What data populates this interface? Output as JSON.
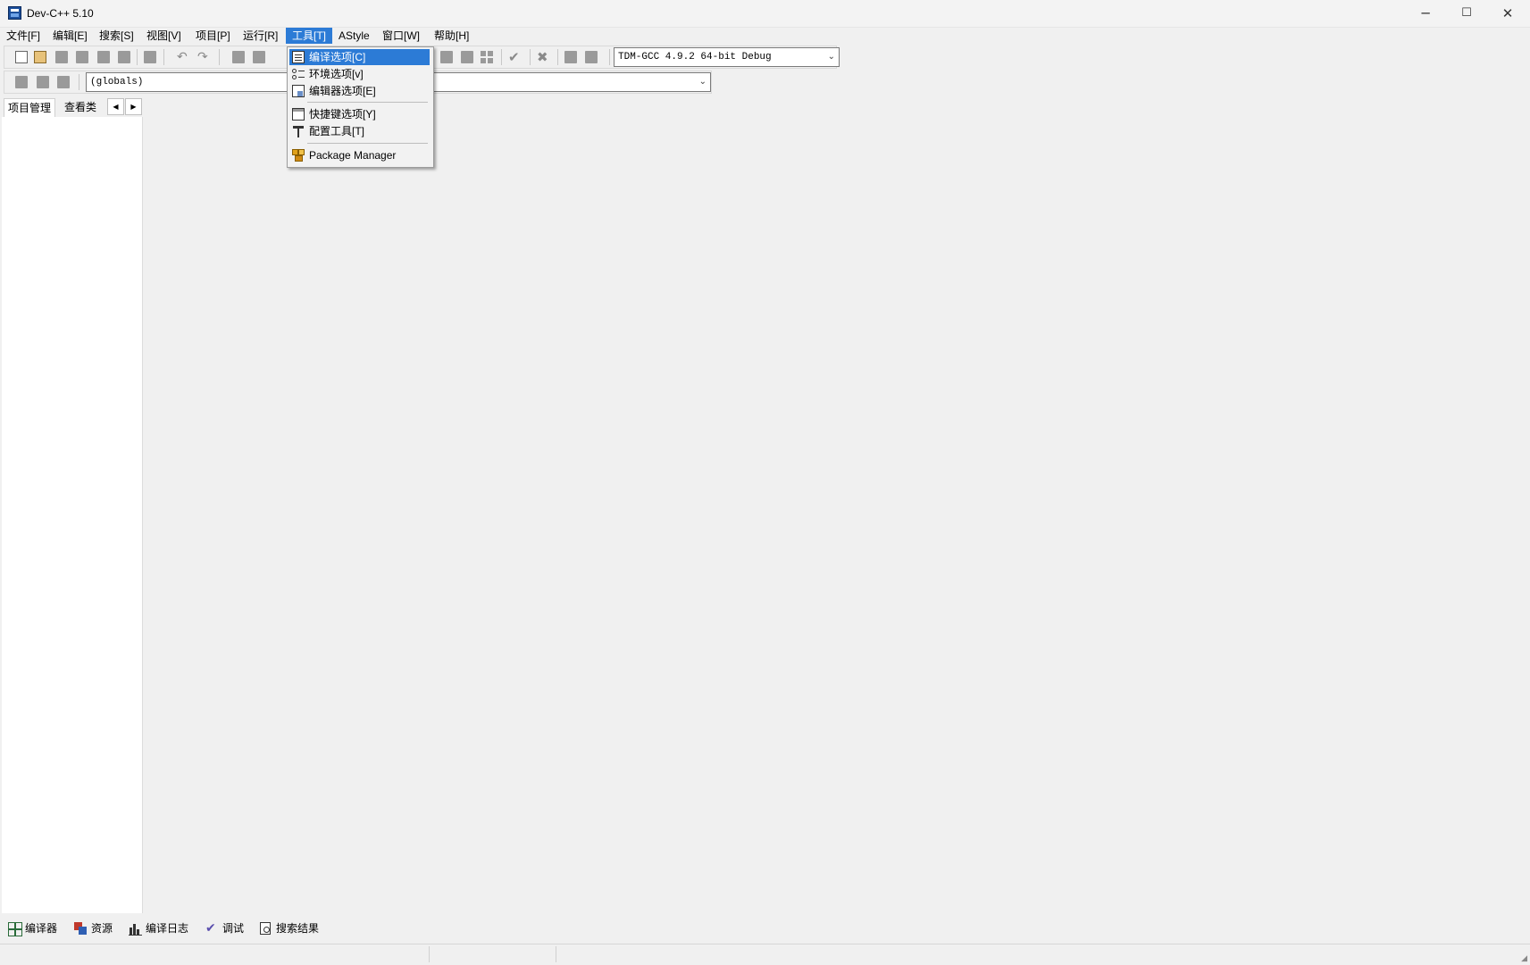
{
  "window": {
    "title": "Dev-C++ 5.10"
  },
  "menubar": {
    "items": [
      {
        "label": "文件[F]"
      },
      {
        "label": "编辑[E]"
      },
      {
        "label": "搜索[S]"
      },
      {
        "label": "视图[V]"
      },
      {
        "label": "项目[P]"
      },
      {
        "label": "运行[R]"
      },
      {
        "label": "工具[T]"
      },
      {
        "label": "AStyle"
      },
      {
        "label": "窗口[W]"
      },
      {
        "label": "帮助[H]"
      }
    ],
    "active_index": 6
  },
  "toolbar": {
    "compiler_select": "TDM-GCC 4.9.2 64-bit Debug",
    "scope_select": "(globals)"
  },
  "tools_menu": {
    "items": [
      {
        "label": "编译选项[C]",
        "icon": "compiler-options-icon",
        "highlighted": true
      },
      {
        "label": "环境选项[v]",
        "icon": "environment-options-icon"
      },
      {
        "label": "编辑器选项[E]",
        "icon": "editor-options-icon"
      },
      {
        "label": "快捷键选项[Y]",
        "icon": "shortcut-options-icon"
      },
      {
        "label": "配置工具[T]",
        "icon": "hammer-icon"
      },
      {
        "label": "Package Manager",
        "icon": "package-manager-icon"
      }
    ]
  },
  "left_panel": {
    "tabs": [
      {
        "label": "项目管理"
      },
      {
        "label": "查看类"
      }
    ]
  },
  "bottom_tabs": [
    {
      "label": "编译器",
      "icon": "compiler-grid-icon"
    },
    {
      "label": "资源",
      "icon": "resources-icon"
    },
    {
      "label": "编译日志",
      "icon": "compile-log-chart-icon"
    },
    {
      "label": "调试",
      "icon": "debug-check-icon"
    },
    {
      "label": "搜索结果",
      "icon": "search-results-icon"
    }
  ],
  "colors": {
    "menu_highlight": "#2c7bd6",
    "window_bg": "#f0f0f0"
  }
}
